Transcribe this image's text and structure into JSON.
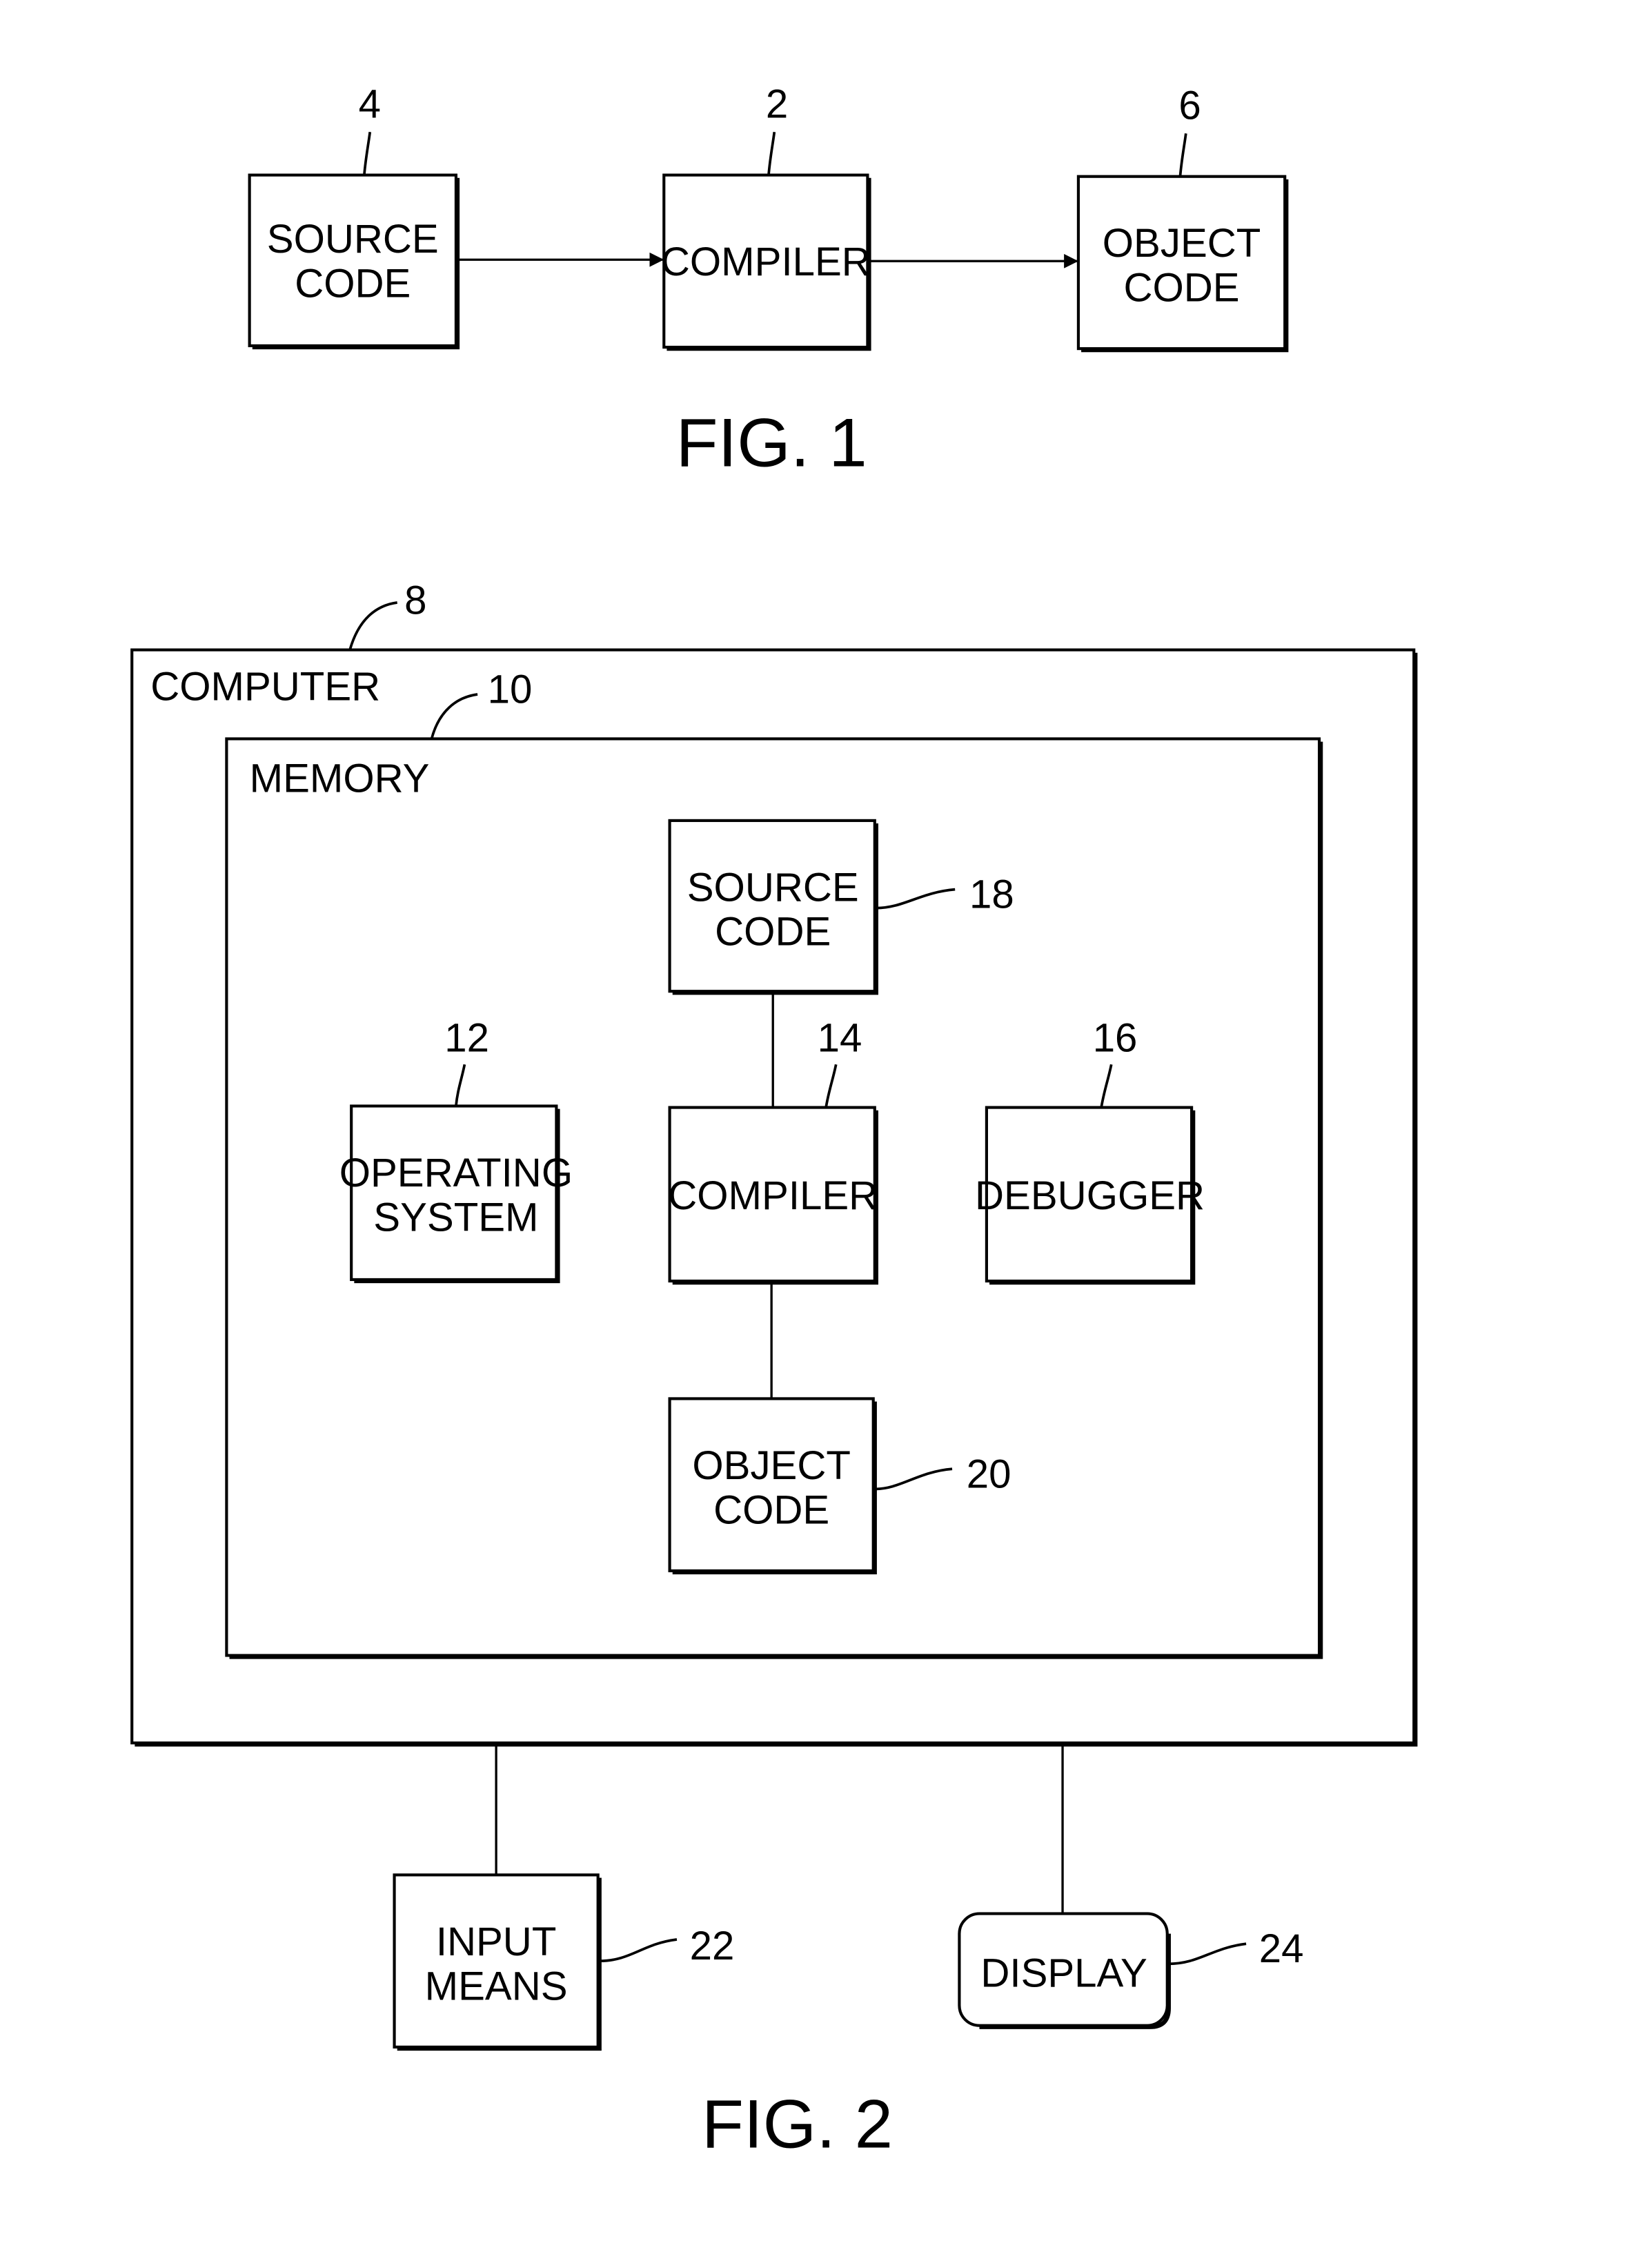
{
  "figure1": {
    "caption": "FIG. 1",
    "blocks": [
      {
        "id": "source",
        "lines": [
          "SOURCE",
          "CODE"
        ],
        "ref": "4"
      },
      {
        "id": "compiler",
        "lines": [
          "COMPILER"
        ],
        "ref": "2"
      },
      {
        "id": "object",
        "lines": [
          "OBJECT",
          "CODE"
        ],
        "ref": "6"
      }
    ],
    "arrows": [
      [
        "source",
        "compiler"
      ],
      [
        "compiler",
        "object"
      ]
    ]
  },
  "figure2": {
    "caption": "FIG. 2",
    "computer": {
      "label": "COMPUTER",
      "ref": "8"
    },
    "memory": {
      "label": "MEMORY",
      "ref": "10"
    },
    "blocks": [
      {
        "id": "source",
        "lines": [
          "SOURCE",
          "CODE"
        ],
        "ref": "18"
      },
      {
        "id": "os",
        "lines": [
          "OPERATING",
          "SYSTEM"
        ],
        "ref": "12"
      },
      {
        "id": "compiler",
        "lines": [
          "COMPILER"
        ],
        "ref": "14"
      },
      {
        "id": "debugger",
        "lines": [
          "DEBUGGER"
        ],
        "ref": "16"
      },
      {
        "id": "object",
        "lines": [
          "OBJECT",
          "CODE"
        ],
        "ref": "20"
      },
      {
        "id": "input",
        "lines": [
          "INPUT",
          "MEANS"
        ],
        "ref": "22"
      },
      {
        "id": "display",
        "lines": [
          "DISPLAY"
        ],
        "ref": "24"
      }
    ],
    "connections": [
      [
        "source",
        "compiler"
      ],
      [
        "compiler",
        "object"
      ],
      [
        "computer",
        "input"
      ],
      [
        "computer",
        "display"
      ]
    ]
  }
}
